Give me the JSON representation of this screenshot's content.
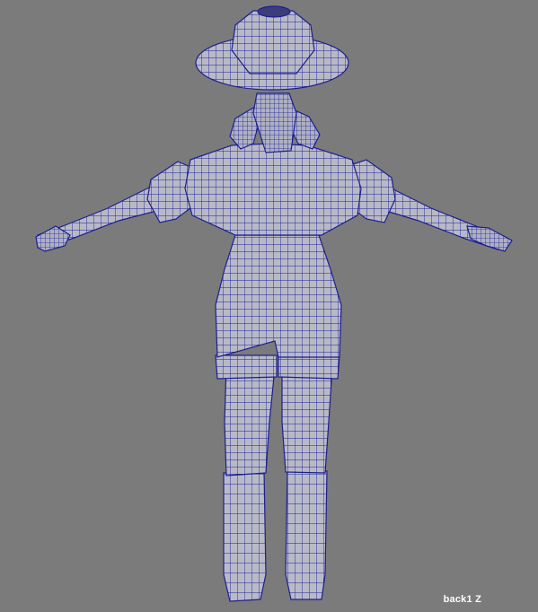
{
  "viewport": {
    "camera_label": "back1 Z",
    "background_color": "#7b7b7b",
    "wire_color": "#1c1f9a",
    "mesh_fill_color": "#b9bac6"
  }
}
